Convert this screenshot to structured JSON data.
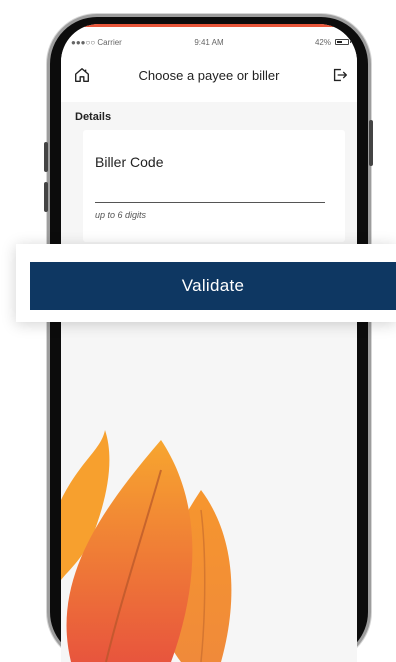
{
  "status": {
    "carrier": "●●●○○ Carrier",
    "time": "9:41 AM",
    "battery": "42%"
  },
  "header": {
    "title": "Choose a payee or biller"
  },
  "details": {
    "section_label": "Details",
    "field_label": "Biller Code",
    "hint": "up to 6 digits"
  },
  "validate": {
    "label": "Validate"
  },
  "colors": {
    "primary": "#0e3762",
    "accent_orange": "#f29432",
    "accent_red": "#e8563a"
  }
}
